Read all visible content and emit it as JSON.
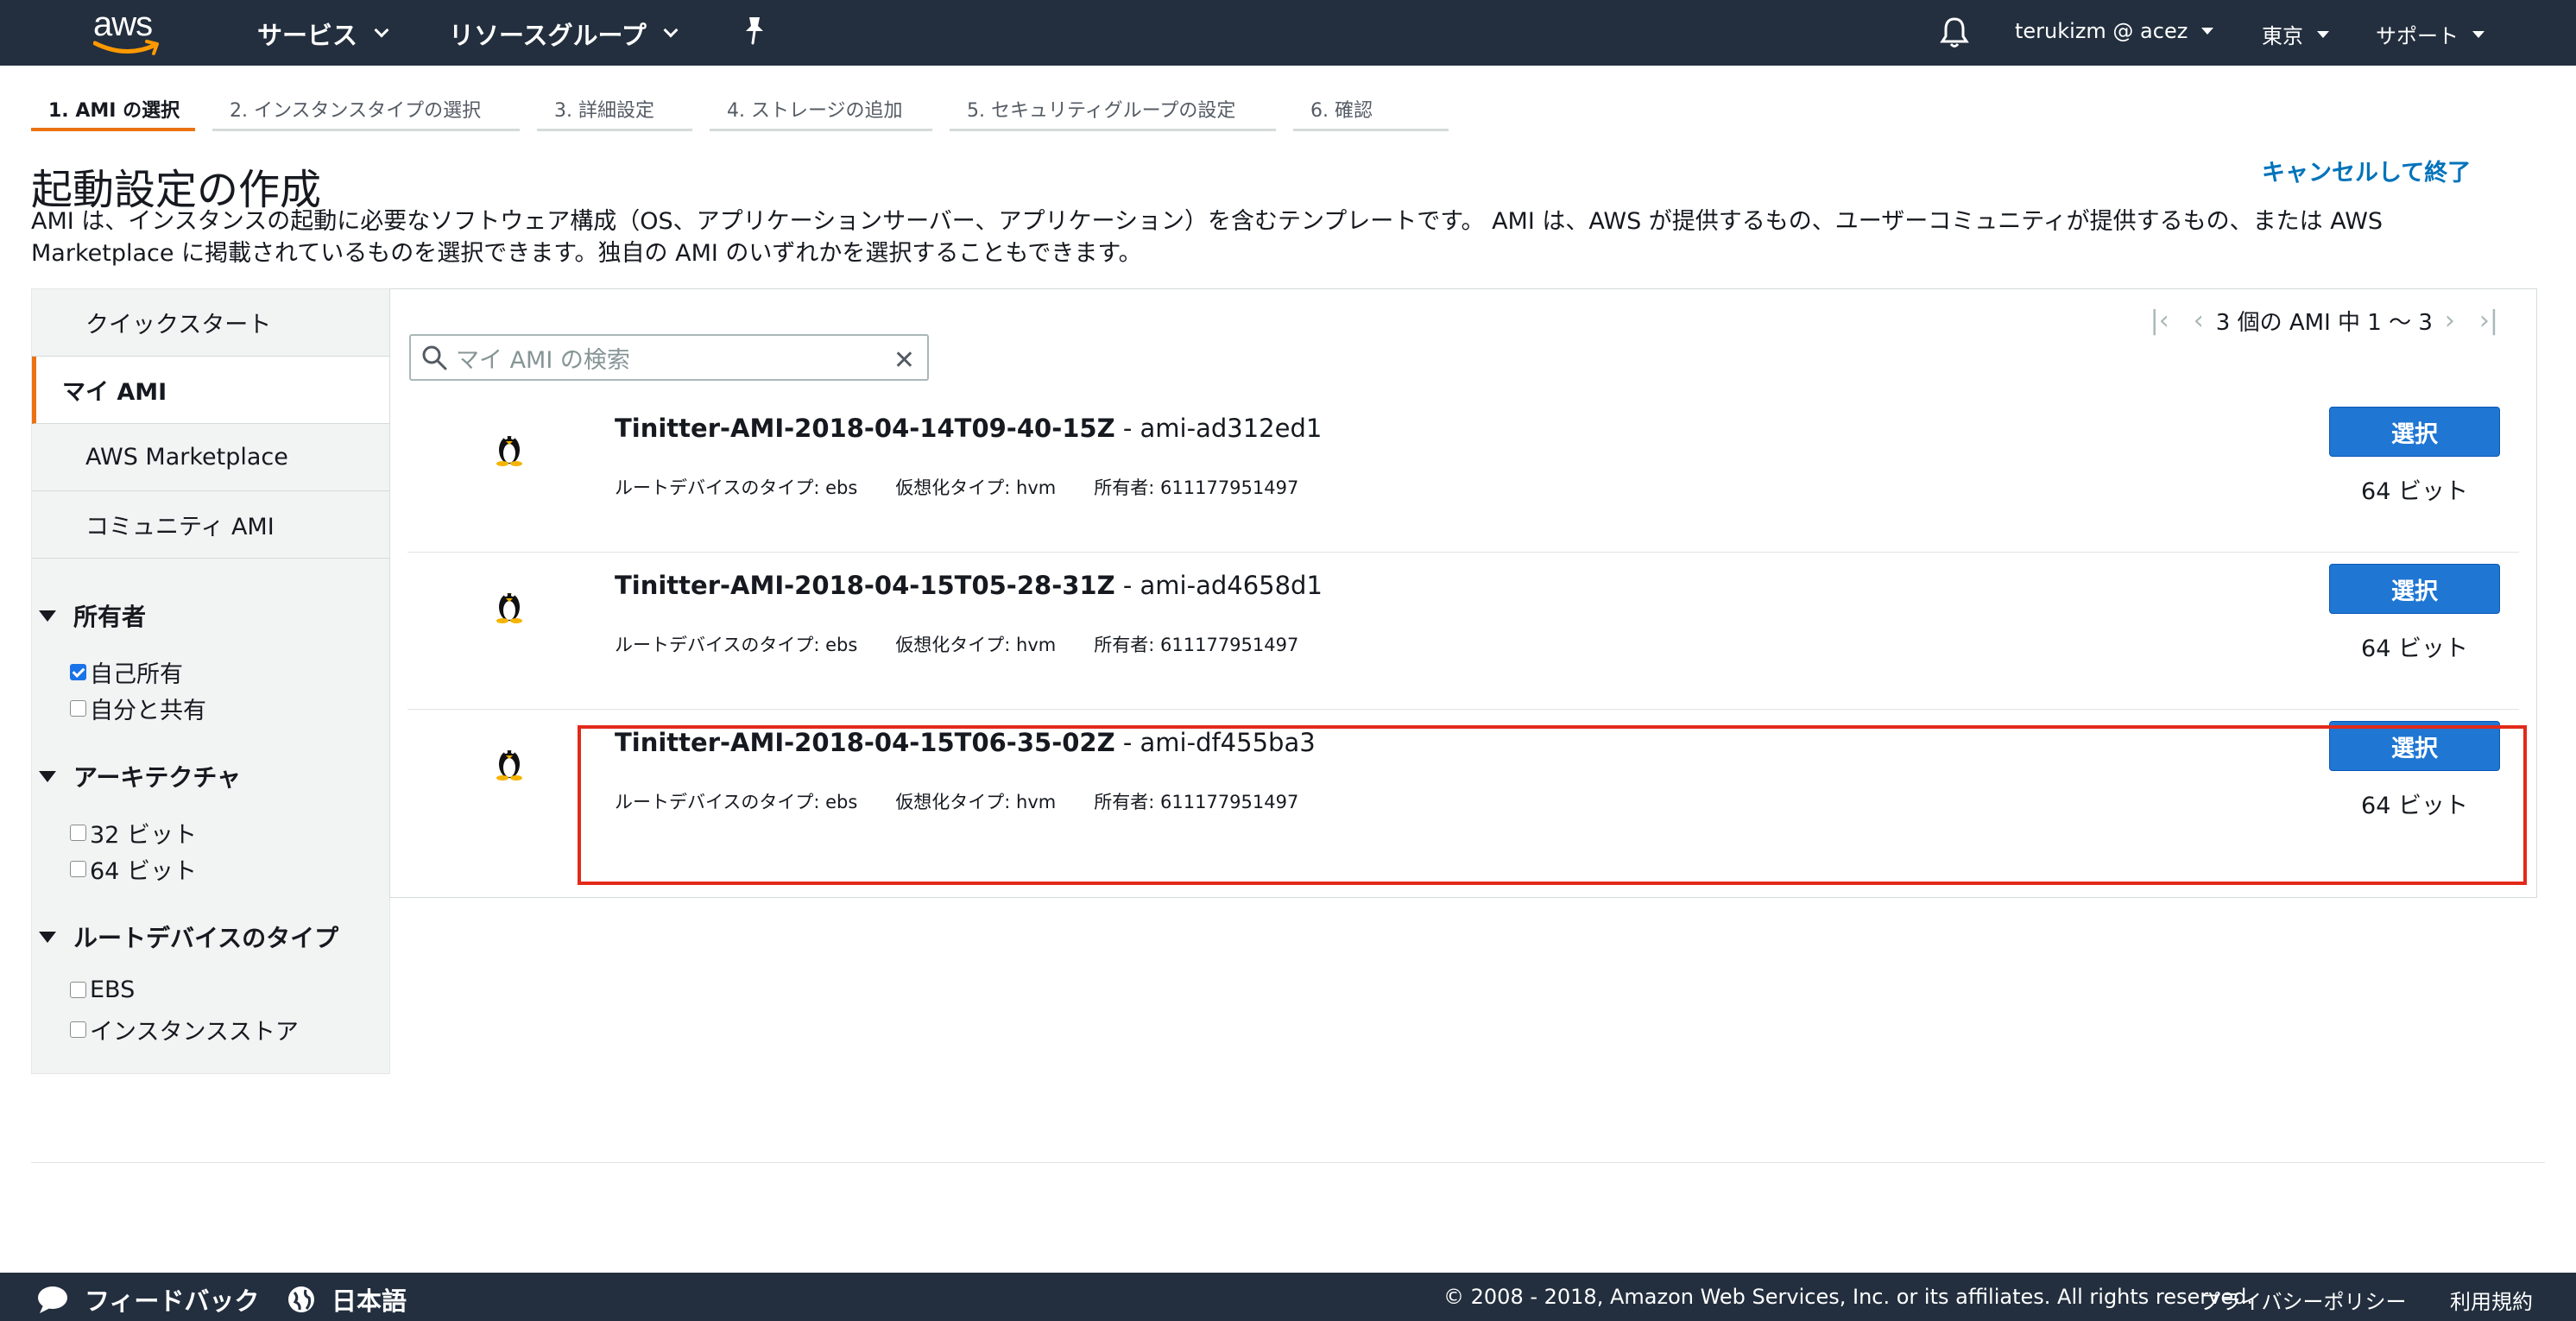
{
  "header": {
    "logo_text": "aws",
    "services": "サービス",
    "resource_groups": "リソースグループ",
    "user": "terukizm @ acez",
    "region": "東京",
    "support": "サポート"
  },
  "wizard_tabs": [
    {
      "label": "1. AMI の選択",
      "active": true
    },
    {
      "label": "2. インスタンスタイプの選択"
    },
    {
      "label": "3. 詳細設定"
    },
    {
      "label": "4. ストレージの追加"
    },
    {
      "label": "5. セキュリティグループの設定"
    },
    {
      "label": "6. 確認"
    }
  ],
  "page": {
    "title": "起動設定の作成",
    "cancel": "キャンセルして終了",
    "description": "AMI は、インスタンスの起動に必要なソフトウェア構成（OS、アプリケーションサーバー、アプリケーション）を含むテンプレートです。 AMI は、AWS が提供するもの、ユーザーコミュニティが提供するもの、または AWS Marketplace に掲載されているものを選択できます。独自の AMI のいずれかを選択することもできます。"
  },
  "sidebar": {
    "tabs": [
      "クイックスタート",
      "マイ AMI",
      "AWS Marketplace",
      "コミュニティ AMI"
    ],
    "active_tab": "マイ AMI",
    "filters": {
      "owner": {
        "title": "所有者",
        "options": [
          {
            "label": "自己所有",
            "checked": true
          },
          {
            "label": "自分と共有",
            "checked": false
          }
        ]
      },
      "arch": {
        "title": "アーキテクチャ",
        "options": [
          {
            "label": "32 ビット",
            "checked": false
          },
          {
            "label": "64 ビット",
            "checked": false
          }
        ]
      },
      "root": {
        "title": "ルートデバイスのタイプ",
        "options": [
          {
            "label": "EBS",
            "checked": false
          },
          {
            "label": "インスタンスストア",
            "checked": false
          }
        ]
      }
    }
  },
  "search": {
    "placeholder": "マイ AMI の検索"
  },
  "pager": {
    "text": "3 個の AMI 中 1 〜 3"
  },
  "amis": [
    {
      "name": "Tinitter-AMI-2018-04-14T09-40-15Z",
      "id": " - ami-ad312ed1",
      "root": "ルートデバイスのタイプ: ebs",
      "virt": "仮想化タイプ: hvm",
      "owner": "所有者: 611177951497",
      "select": "選択",
      "bits": "64 ビット"
    },
    {
      "name": "Tinitter-AMI-2018-04-15T05-28-31Z",
      "id": " - ami-ad4658d1",
      "root": "ルートデバイスのタイプ: ebs",
      "virt": "仮想化タイプ: hvm",
      "owner": "所有者: 611177951497",
      "select": "選択",
      "bits": "64 ビット"
    },
    {
      "name": "Tinitter-AMI-2018-04-15T06-35-02Z",
      "id": " - ami-df455ba3",
      "root": "ルートデバイスのタイプ: ebs",
      "virt": "仮想化タイプ: hvm",
      "owner": "所有者: 611177951497",
      "select": "選択",
      "bits": "64 ビット"
    }
  ],
  "footer": {
    "feedback": "フィードバック",
    "language": "日本語",
    "copyright": "© 2008 - 2018, Amazon Web Services, Inc. or its affiliates. All rights reserved.",
    "privacy": "プライバシーポリシー",
    "terms": "利用規約"
  },
  "colors": {
    "topbar": "#232f3e",
    "accent_orange": "#ec7211",
    "link_blue": "#0073bb",
    "button_blue": "#1f76d3",
    "highlight_red": "#e22a1a"
  }
}
